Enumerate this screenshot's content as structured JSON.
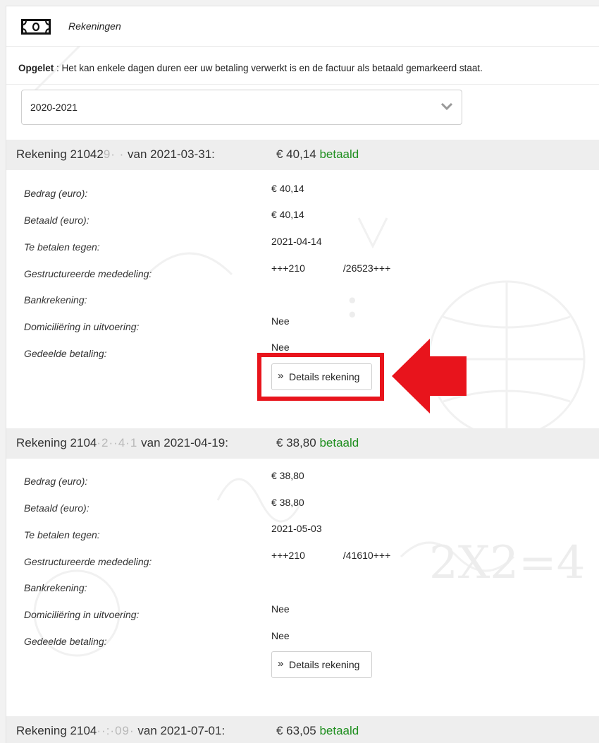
{
  "header": {
    "title": "Rekeningen",
    "icon": "money-icon"
  },
  "notice": {
    "bold": "Opgelet",
    "text": " : Het kan enkele dagen duren eer uw betaling verwerkt is en de factuur als betaald gemarkeerd staat."
  },
  "year_select": {
    "value": "2020-2021"
  },
  "labels": {
    "amount": "Bedrag (euro):",
    "paid": "Betaald (euro):",
    "due": "Te betalen tegen:",
    "structured": "Gestructureerde mededeling:",
    "bank": "Bankrekening:",
    "domiciliation": "Domiciliëring in uitvoering:",
    "split": "Gedeelde betaling:"
  },
  "details_label": "Details rekening",
  "colors": {
    "paid_status": "#1f8f1f",
    "highlight": "#e8141c"
  },
  "invoices": [
    {
      "prefix": "Rekening 21042",
      "blurred": "9·  ·",
      "date_text": " van 2021-03-31:",
      "amount_text": "€ 40,14",
      "status": "betaald",
      "amount": "€ 40,14",
      "paid": "€ 40,14",
      "due": "2021-04-14",
      "structured_start": "+++210",
      "structured_end": "/26523+++",
      "bank": "",
      "domiciliation": "Nee",
      "split": "Nee"
    },
    {
      "prefix": "Rekening 2104",
      "blurred": "·2··4·1",
      "date_text": " van 2021-04-19:",
      "amount_text": "€ 38,80",
      "status": "betaald",
      "amount": "€ 38,80",
      "paid": "€ 38,80",
      "due": "2021-05-03",
      "structured_start": "+++210",
      "structured_end": "/41610+++",
      "bank": "",
      "domiciliation": "Nee",
      "split": "Nee"
    },
    {
      "prefix": "Rekening 2104",
      "blurred": "··:·09·",
      "date_text": " van 2021-07-01:",
      "amount_text": "€ 63,05",
      "status": "betaald"
    }
  ]
}
